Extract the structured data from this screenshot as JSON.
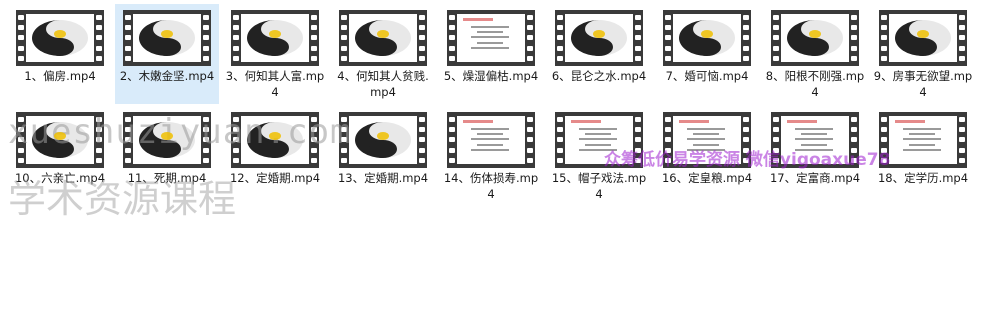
{
  "files": [
    {
      "name": "1、偏房.mp4",
      "thumb": "yinyang",
      "selected": false
    },
    {
      "name": "2、木嫩金坚.mp4",
      "thumb": "yinyang",
      "selected": true
    },
    {
      "name": "3、何知其人富.mp4",
      "thumb": "yinyang",
      "selected": false
    },
    {
      "name": "4、何知其人贫贱.mp4",
      "thumb": "yinyang",
      "selected": false
    },
    {
      "name": "5、燥湿偏枯.mp4",
      "thumb": "document",
      "selected": false
    },
    {
      "name": "6、昆仑之水.mp4",
      "thumb": "yinyang",
      "selected": false
    },
    {
      "name": "7、婚可恼.mp4",
      "thumb": "yinyang",
      "selected": false
    },
    {
      "name": "8、阳根不刚强.mp4",
      "thumb": "yinyang",
      "selected": false
    },
    {
      "name": "9、房事无欲望.mp4",
      "thumb": "yinyang",
      "selected": false
    },
    {
      "name": "10、六亲亡.mp4",
      "thumb": "yinyang",
      "selected": false
    },
    {
      "name": "11、死期.mp4",
      "thumb": "yinyang",
      "selected": false
    },
    {
      "name": "12、定婚期.mp4",
      "thumb": "yinyang",
      "selected": false
    },
    {
      "name": "13、定婚期.mp4",
      "thumb": "yinyang",
      "selected": false
    },
    {
      "name": "14、伤体损寿.mp4",
      "thumb": "document",
      "selected": false
    },
    {
      "name": "15、帽子戏法.mp4",
      "thumb": "document",
      "selected": false
    },
    {
      "name": "16、定皇粮.mp4",
      "thumb": "document",
      "selected": false
    },
    {
      "name": "17、定富商.mp4",
      "thumb": "document",
      "selected": false
    },
    {
      "name": "18、定学历.mp4",
      "thumb": "document",
      "selected": false
    }
  ],
  "watermarks": {
    "site": "xueshuziyuan.com",
    "cn": "学术资源课程",
    "contact": "众筹低价易学资源  微信yigoaxue78"
  }
}
